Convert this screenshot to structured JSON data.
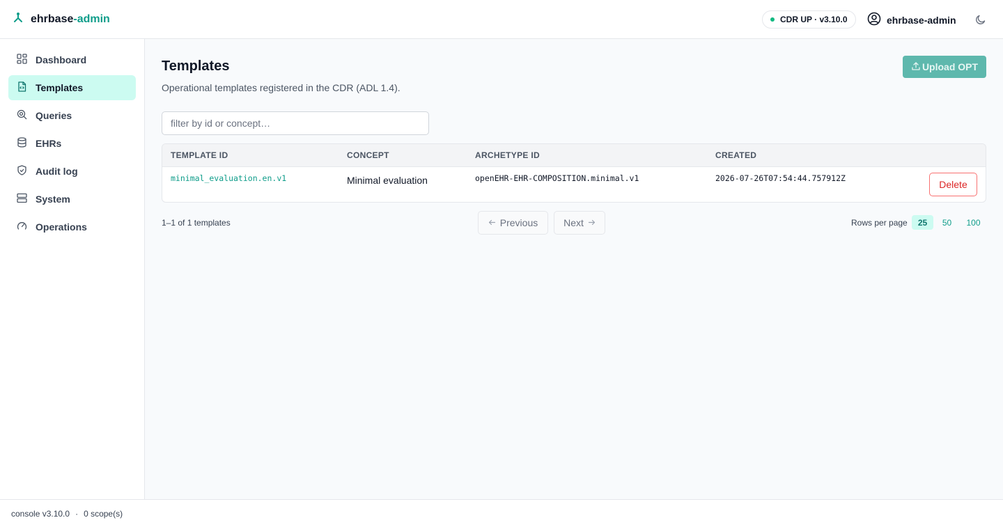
{
  "brand": {
    "name_prefix": "ehrbase",
    "name_accent": "-admin",
    "icon": "git-fork-icon"
  },
  "header": {
    "cdr_status": "CDR UP · v3.10.0",
    "status_color": "#10b981",
    "user_name": "ehrbase-admin",
    "user_icon": "user-circle-icon",
    "theme_icon": "moon-icon"
  },
  "sidebar": {
    "items": [
      {
        "label": "Dashboard",
        "icon": "dashboard-icon",
        "active": false
      },
      {
        "label": "Templates",
        "icon": "file-code-icon",
        "active": true
      },
      {
        "label": "Queries",
        "icon": "search-icon",
        "active": false
      },
      {
        "label": "EHRs",
        "icon": "database-icon",
        "active": false
      },
      {
        "label": "Audit log",
        "icon": "shield-check-icon",
        "active": false
      },
      {
        "label": "System",
        "icon": "server-icon",
        "active": false
      },
      {
        "label": "Operations",
        "icon": "gauge-icon",
        "active": false
      }
    ]
  },
  "page": {
    "title": "Templates",
    "subtitle": "Operational templates registered in the CDR (ADL 1.4).",
    "upload_label": "Upload OPT",
    "filter_placeholder": "filter by id or concept…",
    "filter_value": ""
  },
  "table": {
    "columns": [
      "TEMPLATE ID",
      "CONCEPT",
      "ARCHETYPE ID",
      "CREATED"
    ],
    "rows": [
      {
        "template_id": "minimal_evaluation.en.v1",
        "concept": "Minimal evaluation",
        "archetype_id": "openEHR-EHR-COMPOSITION.minimal.v1",
        "created": "2026-07-26T07:54:44.757912Z",
        "action": "Delete"
      }
    ]
  },
  "pagination": {
    "summary": "1–1 of 1 templates",
    "previous_label": "Previous",
    "next_label": "Next",
    "rows_per_page_label": "Rows per page",
    "options": [
      "25",
      "50",
      "100"
    ],
    "selected": "25"
  },
  "footer": {
    "version": "console v3.10.0",
    "separator": "·",
    "scopes": "0 scope(s)"
  },
  "colors": {
    "accent": "#0f9d8a",
    "active_bg": "#ccfbf1",
    "danger": "#dc2626",
    "upload_disabled": "#5eb8ad"
  }
}
